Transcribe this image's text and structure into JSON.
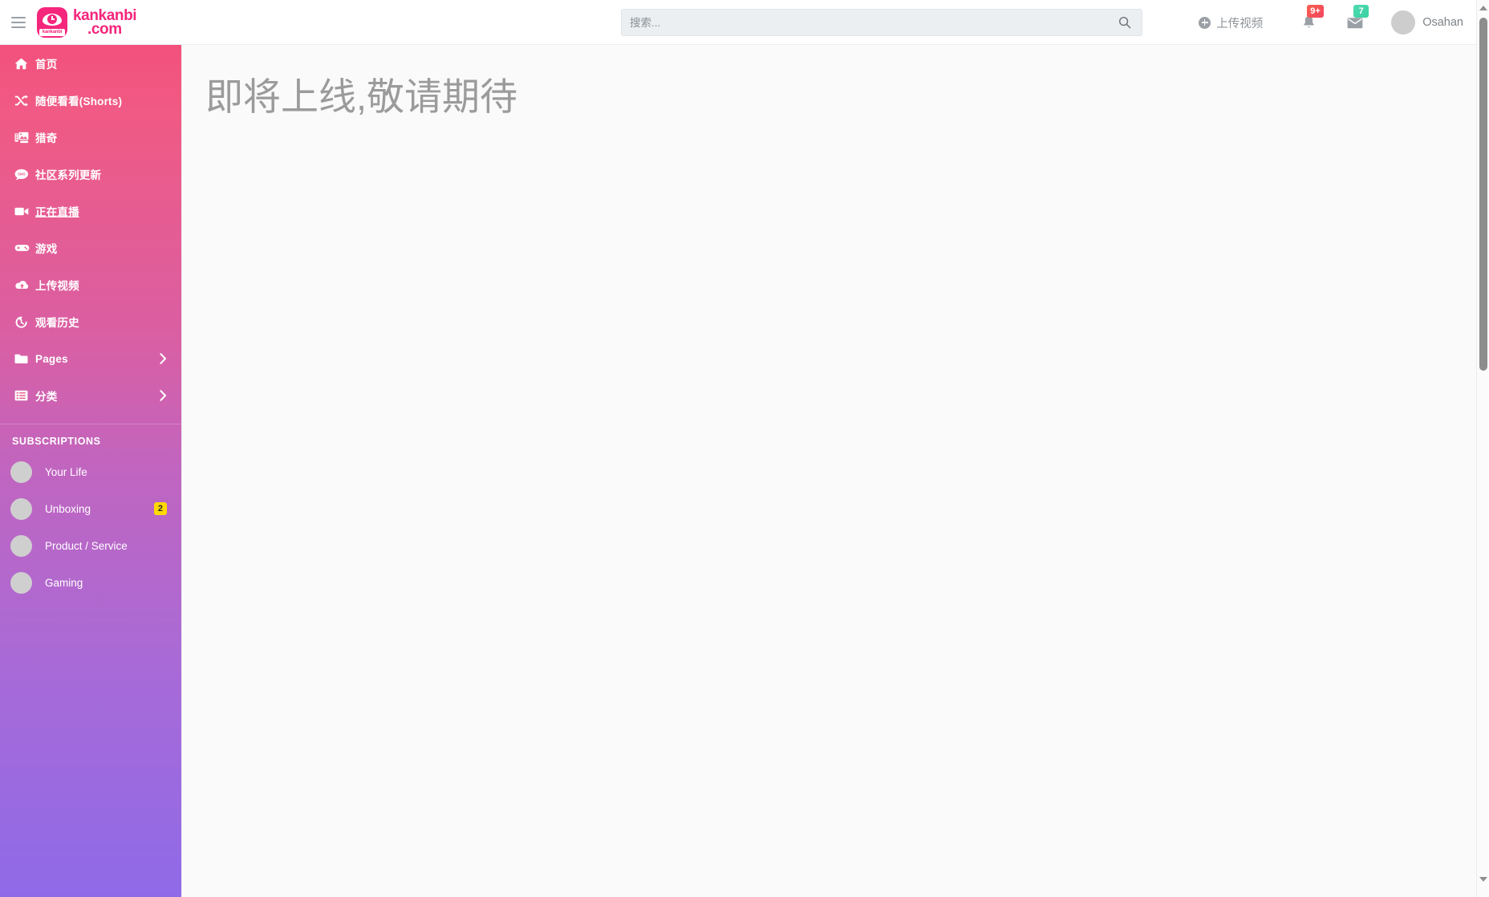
{
  "header": {
    "menu_toggle_name": "menu-toggle",
    "brand": {
      "name": "kankanbi",
      "domain": ".com",
      "mark_text": "kankanbi"
    },
    "search": {
      "value": "",
      "placeholder": "搜索...",
      "icon": "search-icon"
    },
    "upload": {
      "label": "上传视频",
      "icon": "plus-circle-icon"
    },
    "notifications": {
      "icon": "bell-icon",
      "badge": "9+",
      "badge_color": "#f2455f"
    },
    "messages": {
      "icon": "envelope-icon",
      "badge": "7",
      "badge_color": "#3ecfa3"
    },
    "user": {
      "name": "Osahan",
      "avatar": "avatar-placeholder"
    }
  },
  "sidebar": {
    "gradient_from": "#f2517c",
    "gradient_mid": "#c065c0",
    "gradient_to": "#8f6ae8",
    "items": [
      {
        "label": "首页",
        "icon": "home-icon",
        "active": false,
        "chevron": false
      },
      {
        "label": "随便看看(Shorts)",
        "icon": "shuffle-icon",
        "active": false,
        "chevron": false
      },
      {
        "label": "猎奇",
        "icon": "photo-video-icon",
        "active": false,
        "chevron": false
      },
      {
        "label": "社区系列更新",
        "icon": "comment-sms-icon",
        "active": false,
        "chevron": false
      },
      {
        "label": "正在直播",
        "icon": "video-camera-icon",
        "active": true,
        "chevron": false
      },
      {
        "label": "游戏",
        "icon": "gamepad-icon",
        "active": false,
        "chevron": false
      },
      {
        "label": "上传视频",
        "icon": "cloud-upload-icon",
        "active": false,
        "chevron": false
      },
      {
        "label": "观看历史",
        "icon": "history-icon",
        "active": false,
        "chevron": false
      },
      {
        "label": "Pages",
        "icon": "folder-icon",
        "active": false,
        "chevron": true
      },
      {
        "label": "分类",
        "icon": "list-icon",
        "active": false,
        "chevron": true
      }
    ],
    "subscriptions_title": "SUBSCRIPTIONS",
    "subscriptions": [
      {
        "label": "Your Life",
        "badge": ""
      },
      {
        "label": "Unboxing",
        "badge": "2"
      },
      {
        "label": "Product / Service",
        "badge": ""
      },
      {
        "label": "Gaming",
        "badge": ""
      }
    ],
    "badge_color": "#ffd900"
  },
  "main": {
    "message": "即将上线,敬请期待"
  },
  "scrollbar": {
    "up_icon": "chevron-up-icon",
    "down_icon": "chevron-down-icon",
    "thumb": "scrollbar-thumb"
  }
}
